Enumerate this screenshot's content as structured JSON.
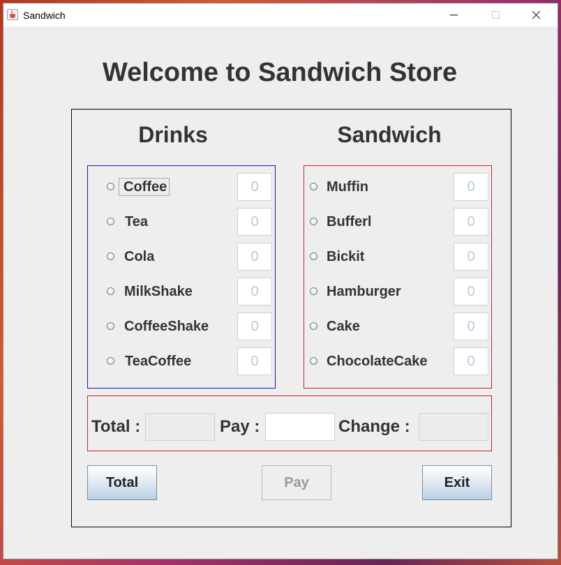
{
  "window": {
    "title": "Sandwich"
  },
  "heading": "Welcome to Sandwich Store",
  "drinks": {
    "title": "Drinks",
    "items": [
      {
        "label": "Coffee",
        "qty": "0"
      },
      {
        "label": "Tea",
        "qty": "0"
      },
      {
        "label": "Cola",
        "qty": "0"
      },
      {
        "label": "MilkShake",
        "qty": "0"
      },
      {
        "label": "CoffeeShake",
        "qty": "0"
      },
      {
        "label": "TeaCoffee",
        "qty": "0"
      }
    ]
  },
  "sandwich": {
    "title": "Sandwich",
    "items": [
      {
        "label": "Muffin",
        "qty": "0"
      },
      {
        "label": "Bufferl",
        "qty": "0"
      },
      {
        "label": "Bickit",
        "qty": "0"
      },
      {
        "label": "Hamburger",
        "qty": "0"
      },
      {
        "label": "Cake",
        "qty": "0"
      },
      {
        "label": "ChocolateCake",
        "qty": "0"
      }
    ]
  },
  "summary": {
    "total_label": "Total :",
    "pay_label": "Pay :",
    "change_label": "Change :",
    "total_value": "",
    "pay_value": "",
    "change_value": ""
  },
  "buttons": {
    "total": "Total",
    "pay": "Pay",
    "exit": "Exit"
  },
  "colors": {
    "drinks_border": "#1a1aa8",
    "sandwich_border": "#cc2222",
    "qty_text": "#b7c9dc"
  }
}
